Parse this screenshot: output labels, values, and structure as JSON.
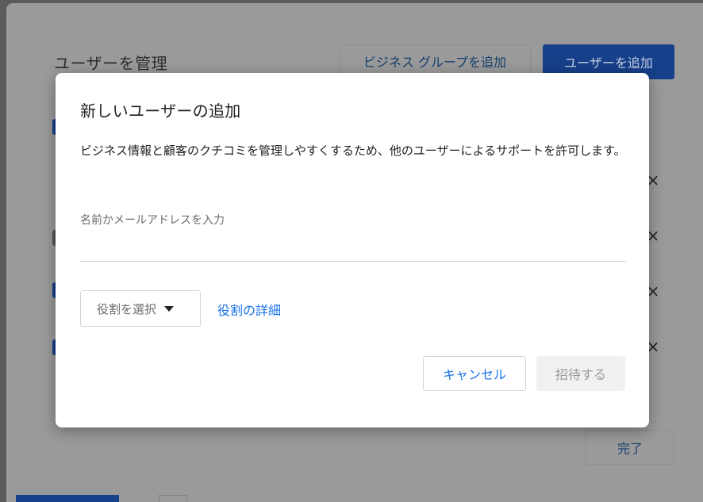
{
  "background": {
    "title": "ユーザーを管理",
    "add_business_group_label": "ビジネス グループを追加",
    "add_user_label": "ユーザーを追加",
    "done_label": "完了",
    "remove_icon": "×"
  },
  "dialog": {
    "title": "新しいユーザーの追加",
    "description": "ビジネス情報と顧客のクチコミを管理しやすくするため、他のユーザーによるサポートを許可します。",
    "name_input": {
      "label": "名前かメールアドレスを入力",
      "value": ""
    },
    "role_select": {
      "selected": "役割を選択",
      "icon": "caret-down-icon"
    },
    "role_details_link": "役割の詳細",
    "cancel_label": "キャンセル",
    "invite_label": "招待する"
  },
  "colors": {
    "accent": "#1a73e8",
    "primary_button": "#17408a",
    "disabled_bg": "#f1f1f1",
    "disabled_text": "#9a9a9a",
    "overlay": "#5b5b5b"
  }
}
